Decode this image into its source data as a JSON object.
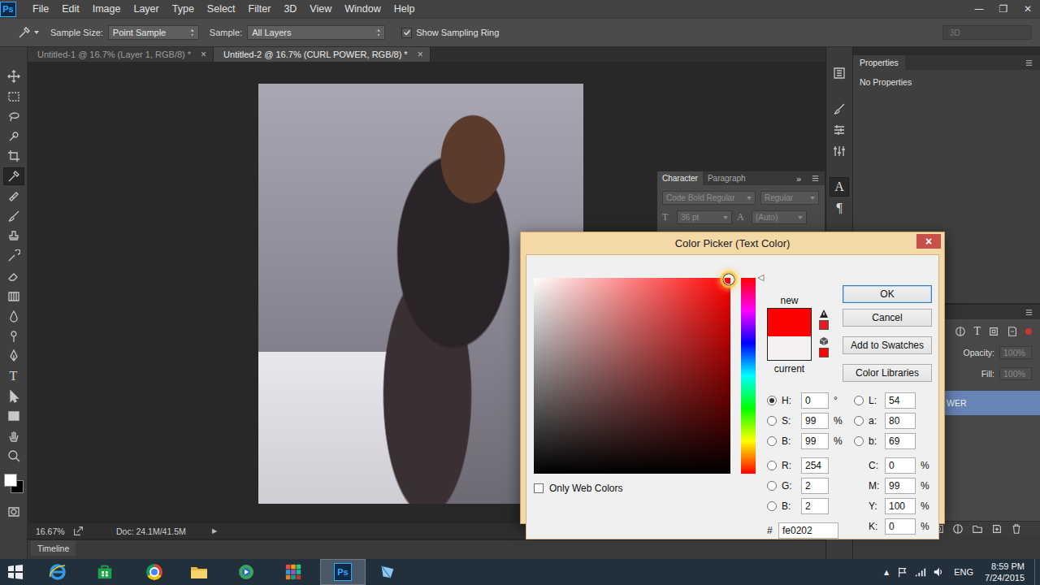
{
  "app": {
    "logo": "Ps",
    "window_controls": [
      "—",
      "❐",
      "✕"
    ]
  },
  "menu": [
    "File",
    "Edit",
    "Image",
    "Layer",
    "Type",
    "Select",
    "Filter",
    "3D",
    "View",
    "Window",
    "Help"
  ],
  "options_bar": {
    "sample_size_label": "Sample Size:",
    "sample_size": "Point Sample",
    "sample_label": "Sample:",
    "sample": "All Layers",
    "sampling_ring": {
      "label": "Show Sampling Ring",
      "checked": true
    },
    "workspace": "3D"
  },
  "doc_tabs": [
    {
      "label": "Untitled-1 @ 16.7% (Layer 1, RGB/8) *",
      "close": "×",
      "selected": false
    },
    {
      "label": "Untitled-2 @ 16.7% (CURL POWER, RGB/8) *",
      "close": "×",
      "selected": true
    }
  ],
  "tools": [
    {
      "kind": "move",
      "selected": false
    },
    {
      "kind": "marquee",
      "selected": false
    },
    {
      "kind": "lasso",
      "selected": false
    },
    {
      "kind": "quick-select",
      "selected": false
    },
    {
      "kind": "crop",
      "selected": false
    },
    {
      "kind": "eyedropper",
      "selected": true
    },
    {
      "kind": "heal",
      "selected": false
    },
    {
      "kind": "brush",
      "selected": false
    },
    {
      "kind": "stamp",
      "selected": false
    },
    {
      "kind": "history-brush",
      "selected": false
    },
    {
      "kind": "eraser",
      "selected": false
    },
    {
      "kind": "gradient",
      "selected": false
    },
    {
      "kind": "blur",
      "selected": false
    },
    {
      "kind": "dodge",
      "selected": false
    },
    {
      "kind": "pen",
      "selected": false
    },
    {
      "kind": "type",
      "label": "T",
      "selected": false
    },
    {
      "kind": "path-select",
      "selected": false
    },
    {
      "kind": "shape",
      "selected": false
    },
    {
      "kind": "hand",
      "selected": false
    },
    {
      "kind": "zoom",
      "selected": false
    }
  ],
  "colors": {
    "foreground": "#ffffff",
    "background": "#000000"
  },
  "panel_strip": [
    {
      "kind": "history",
      "selected": false
    },
    {
      "kind": "brush",
      "selected": false
    },
    {
      "kind": "adjust",
      "selected": false
    },
    {
      "kind": "sliders",
      "selected": false
    },
    {
      "kind": "character",
      "label": "A",
      "selected": true
    },
    {
      "kind": "paragraph",
      "label": "¶",
      "selected": false
    }
  ],
  "properties": {
    "tab": "Properties",
    "text": "No Properties"
  },
  "character_panel": {
    "tabs": [
      {
        "label": "Character",
        "selected": true
      },
      {
        "label": "Paragraph",
        "selected": false
      }
    ],
    "menu": "»",
    "font": "Code Bold Regular",
    "style": "Regular",
    "size_icon": "T",
    "size": "36 pt",
    "leading_icon": "A",
    "leading": "(Auto)"
  },
  "layers_panel": {
    "filters": [
      {
        "kind": "adjust"
      },
      {
        "kind": "type",
        "label": "T"
      },
      {
        "kind": "shape"
      },
      {
        "kind": "smart"
      }
    ],
    "opacity": {
      "label": "Opacity:",
      "value": "100%",
      "disabled": true
    },
    "fill": {
      "label": "Fill:",
      "value": "100%",
      "disabled": true
    },
    "layers": [
      {
        "name": "WER",
        "selected": true
      }
    ],
    "actions": [
      {
        "kind": "link"
      },
      {
        "kind": "fx",
        "label": "fx"
      },
      {
        "kind": "mask"
      },
      {
        "kind": "adjust"
      },
      {
        "kind": "folder"
      },
      {
        "kind": "new"
      },
      {
        "kind": "trash"
      }
    ]
  },
  "status_bar": {
    "zoom": "16.67%",
    "doc": "Doc: 24.1M/41.5M",
    "arrow": "▶"
  },
  "timeline": {
    "label": "Timeline"
  },
  "color_picker": {
    "title": "Color Picker (Text Color)",
    "close": "×",
    "hue": 0,
    "hue_level": 1,
    "saturation": 0.99,
    "brightness": 0.99,
    "new_label": "new",
    "new_color": "#fe0202",
    "current_label": "current",
    "current_color": "#f4f0f4",
    "gamut_color": "#e41b23",
    "websafe_color": "#ff0000",
    "buttons": [
      {
        "label": "OK",
        "default": true
      },
      {
        "label": "Cancel",
        "default": false
      },
      {
        "label": "Add to Swatches",
        "default": false
      },
      {
        "label": "Color Libraries",
        "default": false
      }
    ],
    "left_fields": [
      [
        {
          "label": "H:",
          "value": "0",
          "unit": "°",
          "kind": "radio",
          "selected": true
        },
        {
          "label": "S:",
          "value": "99",
          "unit": "%",
          "kind": "radio",
          "selected": false
        },
        {
          "label": "B:",
          "value": "99",
          "unit": "%",
          "kind": "radio",
          "selected": false
        }
      ],
      [
        {
          "label": "R:",
          "value": "254",
          "kind": "radio",
          "selected": false
        },
        {
          "label": "G:",
          "value": "2",
          "kind": "radio",
          "selected": false
        },
        {
          "label": "B:",
          "value": "2",
          "kind": "radio",
          "selected": false
        }
      ]
    ],
    "right_fields": [
      [
        {
          "label": "L:",
          "value": "54",
          "kind": "radio",
          "selected": false
        },
        {
          "label": "a:",
          "value": "80",
          "kind": "radio",
          "selected": false
        },
        {
          "label": "b:",
          "value": "69",
          "kind": "radio",
          "selected": false
        }
      ],
      [
        {
          "label": "C:",
          "value": "0",
          "unit": "%",
          "kind": "plain",
          "selected": false
        },
        {
          "label": "M:",
          "value": "99",
          "unit": "%",
          "kind": "plain",
          "selected": false
        },
        {
          "label": "Y:",
          "value": "100",
          "unit": "%",
          "kind": "plain",
          "selected": false
        },
        {
          "label": "K:",
          "value": "0",
          "unit": "%",
          "kind": "plain",
          "selected": false
        }
      ]
    ],
    "hex_label": "#",
    "hex": "fe0202",
    "web_colors": {
      "label": "Only Web Colors",
      "checked": false
    }
  },
  "taskbar": {
    "apps": [
      {
        "kind": "start",
        "selected": false
      },
      {
        "kind": "ie",
        "selected": false
      },
      {
        "kind": "store",
        "selected": false
      },
      {
        "kind": "chrome",
        "selected": false
      },
      {
        "kind": "explorer",
        "selected": false
      },
      {
        "kind": "media",
        "selected": false
      },
      {
        "kind": "apps",
        "selected": false
      },
      {
        "kind": "ps",
        "label": "Ps",
        "selected": true
      },
      {
        "kind": "other",
        "selected": false
      }
    ],
    "tray_arrow": "▲",
    "language": "ENG",
    "time": "8:59 PM",
    "date": "7/24/2015"
  }
}
